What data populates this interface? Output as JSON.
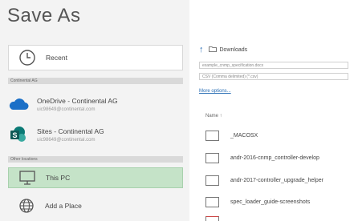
{
  "title": "Save As",
  "locations": {
    "recent": {
      "label": "Recent"
    },
    "section_continental": "Continental AG",
    "onedrive": {
      "label": "OneDrive - Continental AG",
      "email": "uic98649@continental.com"
    },
    "sites": {
      "label": "Sites - Continental AG",
      "email": "uic98649@continental.com"
    },
    "section_other": "Other locations",
    "this_pc": {
      "label": "This PC"
    },
    "add_place": {
      "label": "Add a Place"
    }
  },
  "right": {
    "breadcrumb": "Downloads",
    "filename": "example_cnmp_specification.docx",
    "filetype": "CSV (Comma delimited) (*.csv)",
    "more_options": "More options...",
    "col_name": "Name ↑",
    "files": [
      "_MACOSX",
      "andr-2016-cnmp_controller-develop",
      "andr-2017-controller_upgrade_helper",
      "spec_loader_guide-screenshots"
    ]
  }
}
